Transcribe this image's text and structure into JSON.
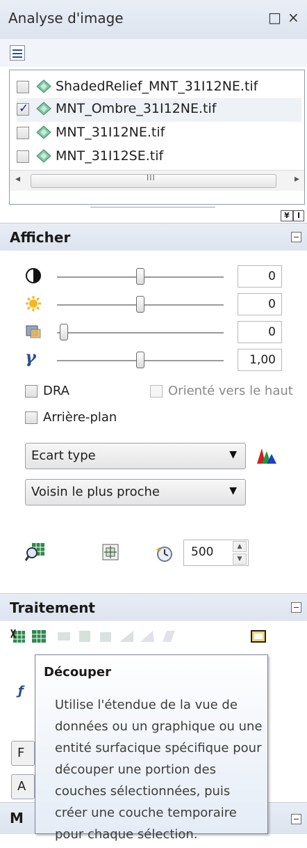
{
  "window": {
    "title": "Analyse d'image",
    "maximize_glyph": "□",
    "close_glyph": "×"
  },
  "layers": [
    {
      "name": "ShadedRelief_MNT_31I12NE.tif",
      "checked": false
    },
    {
      "name": "MNT_Ombre_31I12NE.tif",
      "checked": true
    },
    {
      "name": "MNT_31I12NE.tif",
      "checked": false
    },
    {
      "name": "MNT_31I12SE.tif",
      "checked": false
    }
  ],
  "scrollbar": {
    "grip": "III",
    "left_arrow": "◂",
    "right_arrow": "▸"
  },
  "display": {
    "title": "Afficher",
    "sliders": [
      {
        "icon": "contrast-icon",
        "value": "0",
        "level": 0.5
      },
      {
        "icon": "brightness-icon",
        "value": "0",
        "level": 0.5
      },
      {
        "icon": "transparency-icon",
        "value": "0",
        "level": 0.0
      },
      {
        "icon": "gamma-icon",
        "value": "1,00",
        "level": 0.5,
        "symbol": "γ"
      }
    ],
    "dra_label": "DRA",
    "orient_label": "Orienté vers le haut",
    "background_label": "Arrière-plan",
    "stretch_value": "Ecart type",
    "resample_value": "Voisin le plus proche",
    "refresh_value": "500"
  },
  "processing": {
    "title": "Traitement"
  },
  "tooltip": {
    "title": "Découper",
    "body": "Utilise l'étendue de la vue de données ou un graphique ou une entité surfacique spécifique pour découper une portion des couches sélectionnées, puis créer une couche temporaire pour chaque sélection."
  },
  "partial_labels": {
    "a": "F",
    "b": "A",
    "c": "M"
  },
  "colors": {
    "header": "#dde4ef",
    "accent": "#2a4f8f"
  }
}
